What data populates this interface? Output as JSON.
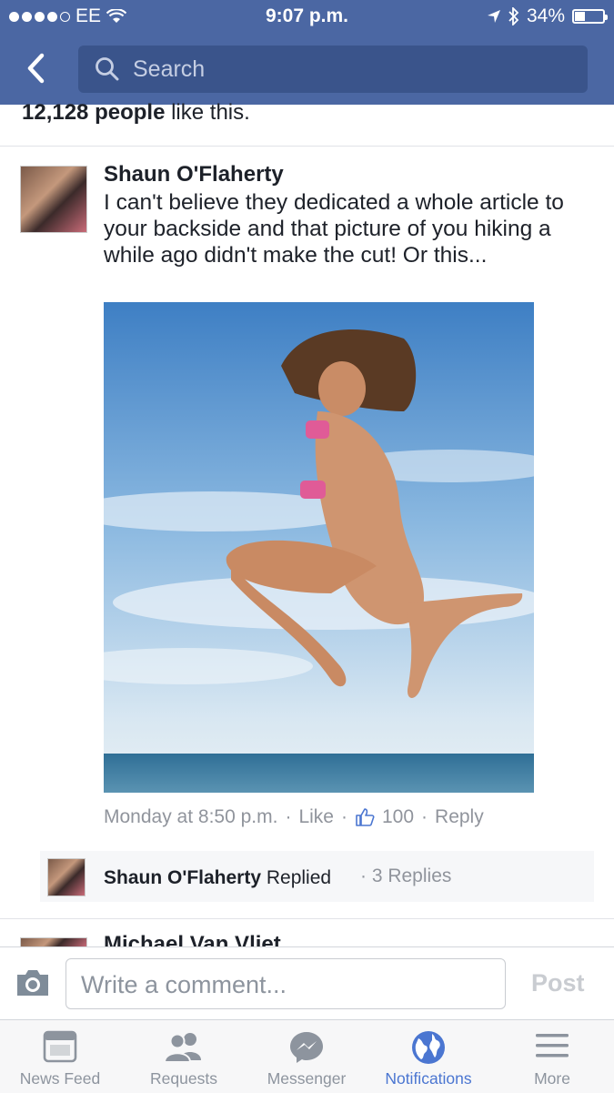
{
  "status_bar": {
    "carrier": "EE",
    "time": "9:07 p.m.",
    "battery": "34%"
  },
  "header": {
    "search_placeholder": "Search"
  },
  "post": {
    "likes_count": "12,128 people",
    "likes_suffix": " like this."
  },
  "comment": {
    "author": "Shaun O'Flaherty",
    "text": "I can't believe they dedicated a whole article to your backside and that picture of you hiking a while ago didn't make the cut! Or this...",
    "timestamp": "Monday at 8:50 p.m.",
    "like_label": "Like",
    "reaction_count": "100",
    "reply_label": "Reply"
  },
  "reply_summary": {
    "author": "Shaun O'Flaherty",
    "action": " Replied",
    "count": "3 Replies"
  },
  "next_comment": {
    "author": "Michael Van Vliet"
  },
  "composer": {
    "placeholder": "Write a comment...",
    "post_label": "Post"
  },
  "tabs": [
    {
      "label": "News Feed",
      "icon": "news-feed-icon"
    },
    {
      "label": "Requests",
      "icon": "friends-icon"
    },
    {
      "label": "Messenger",
      "icon": "messenger-icon"
    },
    {
      "label": "Notifications",
      "icon": "globe-icon",
      "active": true
    },
    {
      "label": "More",
      "icon": "menu-icon"
    }
  ],
  "colors": {
    "brand": "#4b67a3",
    "active_tab": "#4b76d1"
  }
}
